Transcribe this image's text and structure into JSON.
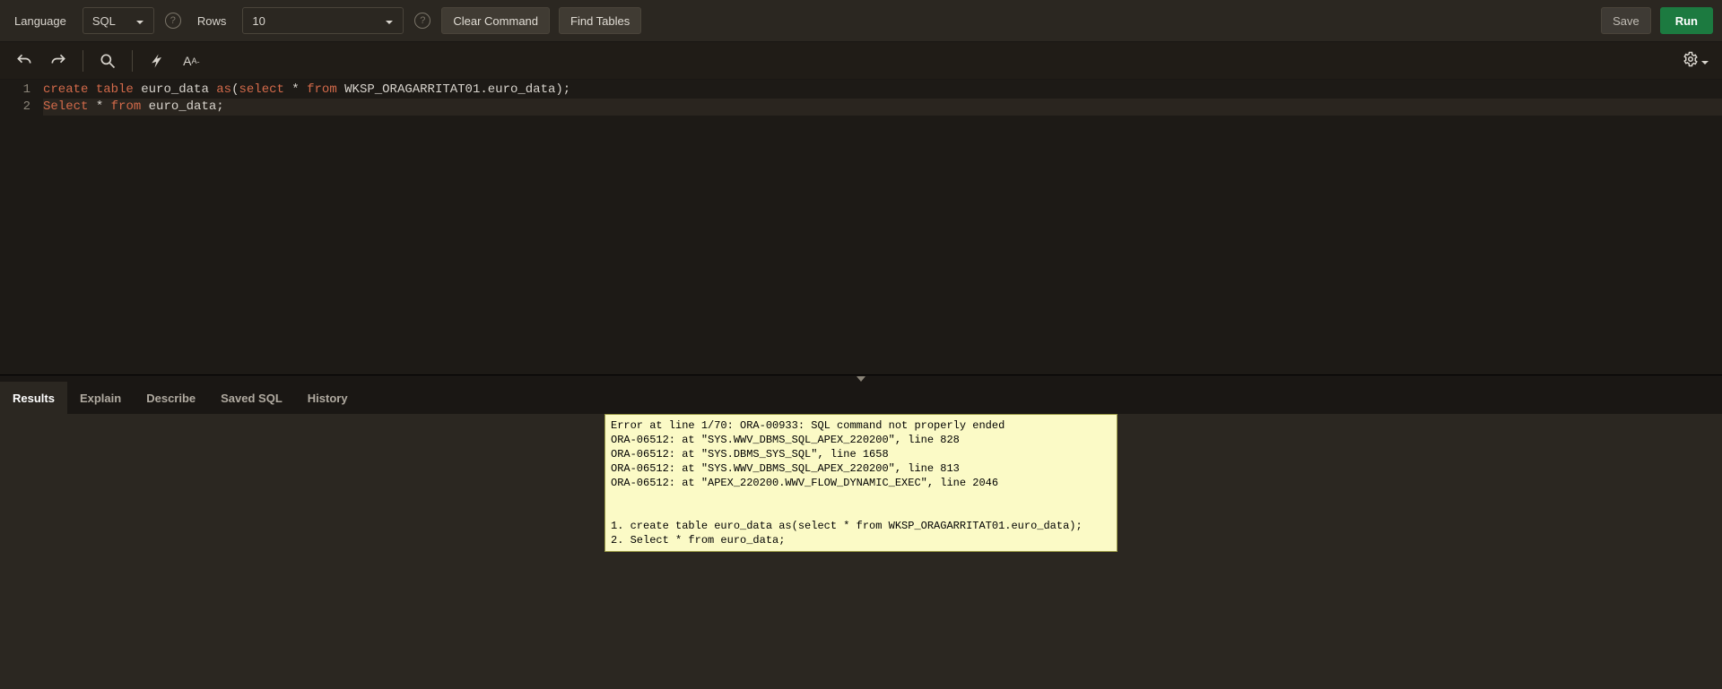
{
  "toolbar": {
    "language_label": "Language",
    "language_value": "SQL",
    "rows_label": "Rows",
    "rows_value": "10",
    "clear_command": "Clear Command",
    "find_tables": "Find Tables",
    "save": "Save",
    "run": "Run"
  },
  "code": {
    "lines": [
      {
        "n": "1",
        "tokens": [
          {
            "t": "create",
            "c": "tok-kw"
          },
          {
            "t": " "
          },
          {
            "t": "table",
            "c": "tok-kw"
          },
          {
            "t": " euro_data ",
            "c": "tok-str"
          },
          {
            "t": "as",
            "c": "tok-kw"
          },
          {
            "t": "(",
            "c": "tok-pnc"
          },
          {
            "t": "select",
            "c": "tok-kw"
          },
          {
            "t": " * ",
            "c": "tok-str"
          },
          {
            "t": "from",
            "c": "tok-kw"
          },
          {
            "t": " WKSP_ORAGARRITAT01.euro_data);",
            "c": "tok-str"
          }
        ]
      },
      {
        "n": "2",
        "hl": true,
        "tokens": [
          {
            "t": "Select",
            "c": "tok-kw"
          },
          {
            "t": " * ",
            "c": "tok-str"
          },
          {
            "t": "from",
            "c": "tok-kw"
          },
          {
            "t": " euro_data;",
            "c": "tok-str"
          }
        ]
      }
    ]
  },
  "tabs": {
    "items": [
      {
        "label": "Results",
        "active": true
      },
      {
        "label": "Explain"
      },
      {
        "label": "Describe"
      },
      {
        "label": "Saved SQL"
      },
      {
        "label": "History"
      }
    ]
  },
  "error_text": "Error at line 1/70: ORA-00933: SQL command not properly ended\nORA-06512: at \"SYS.WWV_DBMS_SQL_APEX_220200\", line 828\nORA-06512: at \"SYS.DBMS_SYS_SQL\", line 1658\nORA-06512: at \"SYS.WWV_DBMS_SQL_APEX_220200\", line 813\nORA-06512: at \"APEX_220200.WWV_FLOW_DYNAMIC_EXEC\", line 2046\n\n\n1. create table euro_data as(select * from WKSP_ORAGARRITAT01.euro_data);\n2. Select * from euro_data;"
}
